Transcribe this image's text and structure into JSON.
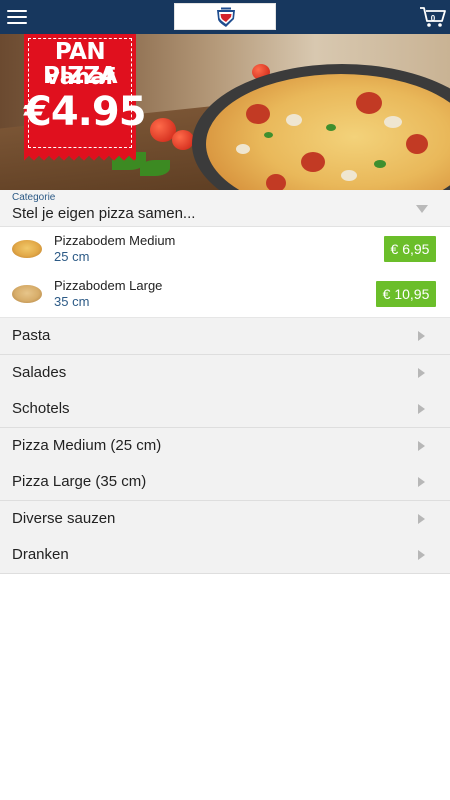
{
  "header": {
    "menu_icon": "hamburger-menu-icon",
    "logo": "restaurant-logo",
    "cart_icon": "shopping-cart-icon",
    "cart_count": "0"
  },
  "hero": {
    "promo_line1": "PAN PIZZA",
    "promo_line2": "vanaf",
    "promo_price": "€4.95"
  },
  "category_select": {
    "label": "Categorie",
    "value": "Stel je eigen pizza samen..."
  },
  "products": [
    {
      "name": "Pizzabodem Medium",
      "size": "25 cm",
      "price": "€ 6,95"
    },
    {
      "name": "Pizzabodem Large",
      "size": "35 cm",
      "price": "€ 10,95"
    }
  ],
  "categories": [
    {
      "label": "Pasta"
    },
    {
      "label": "Salades"
    },
    {
      "label": "Schotels"
    },
    {
      "label": "Pizza Medium (25 cm)"
    },
    {
      "label": "Pizza Large (35 cm)"
    },
    {
      "label": "Diverse sauzen"
    },
    {
      "label": "Dranken"
    }
  ],
  "colors": {
    "header_bg": "#17375e",
    "price_button": "#6bbe2a",
    "accent_text": "#2c5a86",
    "promo_red": "#e0101e"
  }
}
